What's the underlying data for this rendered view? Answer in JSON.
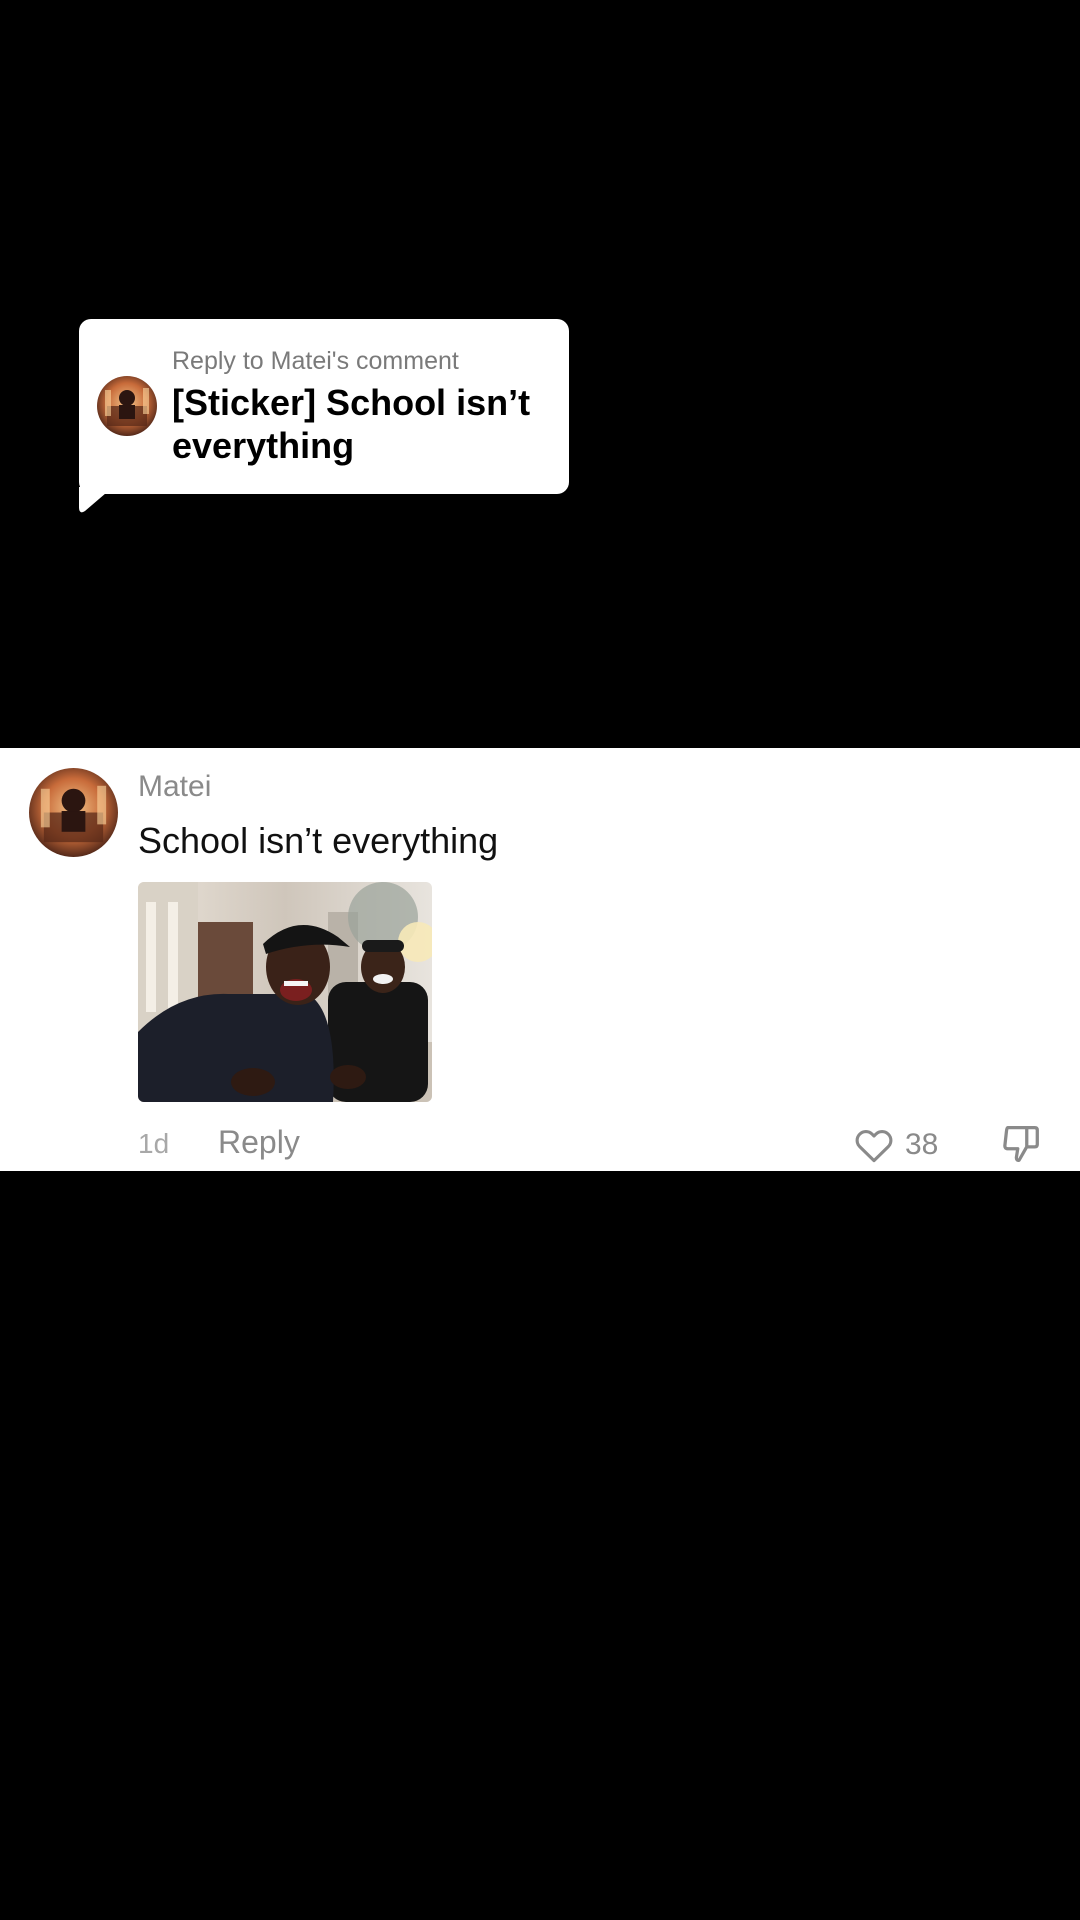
{
  "reply_sticker": {
    "label": "Reply to Matei's comment",
    "text": "[Sticker] School isn’t everything",
    "avatar_icon": "user-avatar"
  },
  "comment": {
    "username": "Matei",
    "text": "School isn’t everything",
    "sticker_image": "laughing-men-sticker",
    "time": "1d",
    "reply_label": "Reply",
    "like_count": "38",
    "like_icon": "heart-icon",
    "dislike_icon": "thumbs-down-icon"
  },
  "colors": {
    "background": "#000000",
    "card": "#ffffff",
    "muted_text": "#8a8a8a",
    "primary_text": "#111111"
  }
}
